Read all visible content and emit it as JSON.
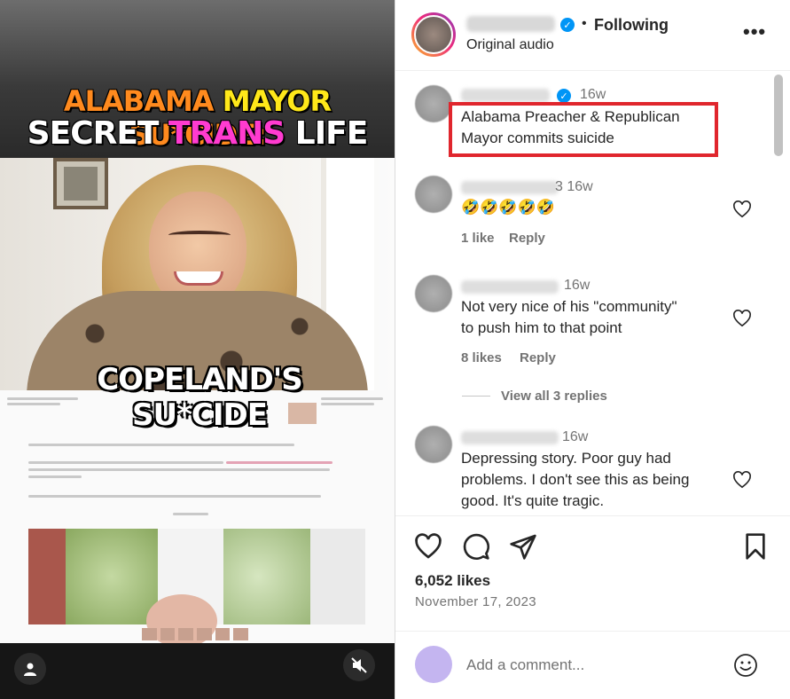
{
  "video": {
    "title_line1": [
      "ALABAMA",
      "MAYOR",
      "SU*CIDE:"
    ],
    "title_line2": [
      "SECRET",
      "TRANS",
      "LIFE"
    ],
    "overlay_line1": "COPELAND'S",
    "overlay_line2": "SU*CIDE"
  },
  "post": {
    "header": {
      "status": "Following",
      "audio": "Original audio",
      "more_icon": "ellipsis-icon"
    },
    "comments": [
      {
        "time": "16w",
        "text_line1": "Alabama Preacher & Republican",
        "text_line2": "Mayor commits suicide"
      },
      {
        "time": "3 16w",
        "text": "🤣🤣🤣🤣🤣",
        "likes": "1 like",
        "reply": "Reply"
      },
      {
        "time": "16w",
        "text_line1": "Not very nice of his \"community\"",
        "text_line2": "to push him to that point",
        "likes": "8 likes",
        "reply": "Reply",
        "view_replies": "View all 3 replies"
      },
      {
        "time": "16w",
        "text_line1": "Depressing story. Poor guy had",
        "text_line2": "problems. I don't see this as being",
        "text_line3": "good. It's quite tragic."
      }
    ],
    "likes": "6,052 likes",
    "date": "November 17, 2023",
    "add_comment_placeholder": "Add a comment..."
  },
  "colors": {
    "highlight": "#e0262d",
    "verified": "#0095f6",
    "title_orange": "#ff8a1e",
    "title_yellow": "#ffe81a",
    "title_pink": "#ff3bd0"
  }
}
